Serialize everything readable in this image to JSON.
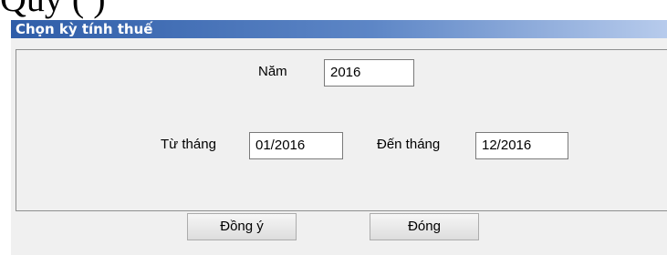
{
  "dialog": {
    "title": "Chọn kỳ tính thuế",
    "year_label": "Năm",
    "year_value": "2016",
    "from_month_label": "Từ tháng",
    "from_month_value": "01/2016",
    "to_month_label": "Đến tháng",
    "to_month_value": "12/2016",
    "ok_label": "Đồng ý",
    "close_label": "Đóng"
  },
  "colors": {
    "title_bar": "#2f5da8",
    "dialog_bg": "#f0f0f0"
  }
}
